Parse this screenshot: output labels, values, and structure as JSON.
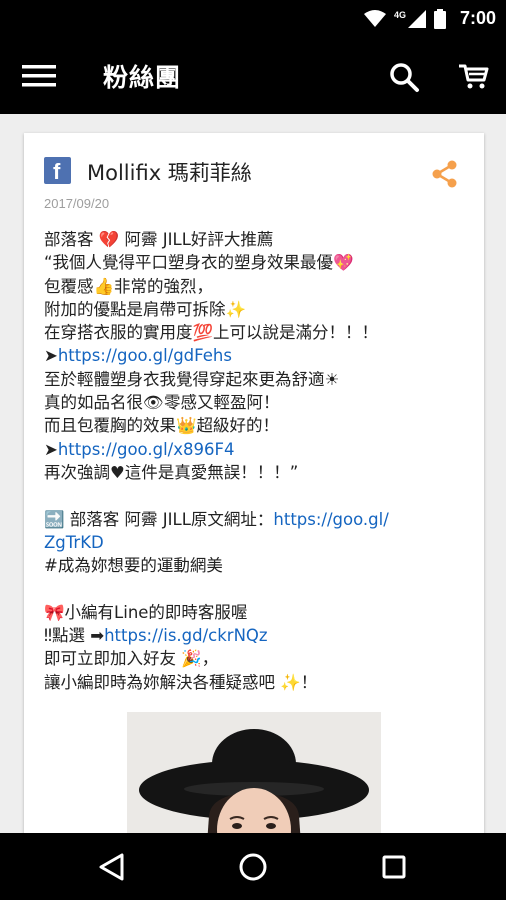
{
  "status": {
    "network": "4G",
    "time": "7:00"
  },
  "toolbar": {
    "title": "粉絲團",
    "menu_icon": "hamburger-menu-icon",
    "search_icon": "search-icon",
    "cart_icon": "shopping-cart-icon"
  },
  "post": {
    "page_name": "Mollifix 瑪莉菲絲",
    "date": "2017/09/20",
    "lines": [
      "部落客 💔 阿霽 JILL好評大推薦",
      "“我個人覺得平口塑身衣的塑身效果最優💖",
      "包覆感👍非常的強烈，",
      "附加的優點是肩帶可拆除✨",
      "在穿搭衣服的實用度💯上可以說是滿分！！！",
      "➤https://goo.gl/gdFehs",
      "至於輕體塑身衣我覺得穿起來更為舒適☀",
      "真的如品名很👁零感又輕盈阿！",
      "而且包覆胸的效果👑超級好的！",
      "➤https://goo.gl/x896F4",
      "再次強調♥這件是真愛無誤！！！”",
      "",
      "🔜 部落客 阿霽 JILL原文網址：https://goo.gl/",
      "ZgTrKD",
      "#成為妳想要的運動網美",
      "",
      "🎀小編有Line的即時客服喔",
      "‼點選 ➡https://is.gd/ckrNQz",
      "即可立即加入好友 🎉，",
      "讓小編即時為妳解決各種疑惑吧 ✨！"
    ],
    "links": [
      "https://goo.gl/gdFehs",
      "https://goo.gl/x896F4",
      "https://goo.gl/",
      "ZgTrKD",
      "https://is.gd/ckrNQz"
    ],
    "photo": "woman-in-black-wide-brim-hat-photo"
  },
  "colors": {
    "bar": "#000000",
    "share": "#f5a04c",
    "link": "#1565c0",
    "facebook": "#4e71b1",
    "background": "#eeeeee"
  },
  "navbar": {
    "back_icon": "back-triangle-icon",
    "home_icon": "home-circle-icon",
    "recents_icon": "recents-square-icon"
  }
}
